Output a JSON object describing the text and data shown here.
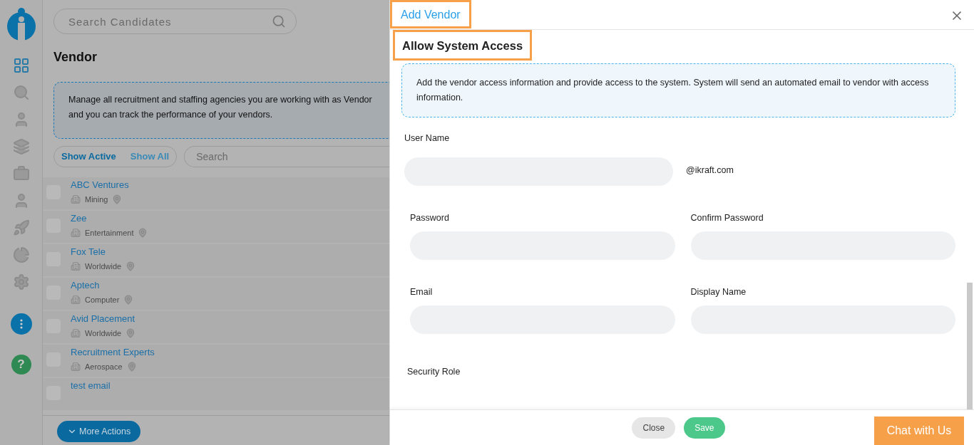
{
  "sidebar": {
    "help": "?"
  },
  "search": {
    "placeholder": "Search Candidates"
  },
  "page": {
    "title": "Vendor",
    "info_lines": [
      "Manage all recruitment and staffing agencies you are working with as Vendor",
      "and you can track the performance of your vendors."
    ]
  },
  "filters": [
    {
      "label": "Show Active",
      "selected": true
    },
    {
      "label": "Show All",
      "selected": false
    }
  ],
  "list_search": {
    "placeholder": "Search"
  },
  "vendors": [
    {
      "name": "ABC Ventures",
      "industry": "Mining",
      "checked": false
    },
    {
      "name": "Zee",
      "industry": "Entertainment",
      "checked": false
    },
    {
      "name": "Fox Tele",
      "industry": "Worldwide",
      "checked": false
    },
    {
      "name": "Aptech",
      "industry": "Computer",
      "checked": false
    },
    {
      "name": "Avid Placement",
      "industry": "Worldwide",
      "checked": false
    },
    {
      "name": "Recruitment Experts",
      "industry": "Aerospace",
      "checked": false
    },
    {
      "name": "test email",
      "checked": false
    }
  ],
  "more_actions": "More Actions",
  "dialog": {
    "title": "Add Vendor",
    "section": "Allow System Access",
    "info": "Add the vendor access information and provide access to the system. System will send an automated email to vendor with access information.",
    "user_name": {
      "label": "User Name",
      "suffix": "@ikraft.com"
    },
    "field_rows": [
      [
        {
          "label": "Password"
        },
        {
          "label": "Confirm Password"
        }
      ],
      [
        {
          "label": "Email"
        },
        {
          "label": "Display Name"
        }
      ]
    ],
    "security_role": "Security Role",
    "buttons": [
      {
        "label": "Close",
        "kind": "secondary"
      },
      {
        "label": "Save",
        "kind": "primary"
      }
    ]
  },
  "chat": "Chat with Us"
}
